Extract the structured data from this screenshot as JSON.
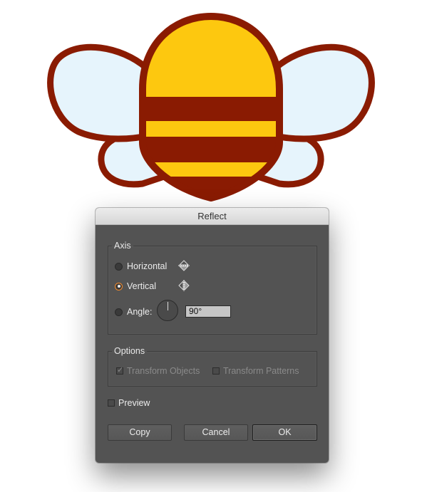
{
  "colors": {
    "outline": "#8a1b02",
    "body_fill": "#fdc80f",
    "wing_fill": "#e6f4fc",
    "dialog_bg": "#535353",
    "radio_accent": "#f28a2e"
  },
  "dialog": {
    "title": "Reflect",
    "axis_group": {
      "legend": "Axis",
      "horizontal_label": "Horizontal",
      "vertical_label": "Vertical",
      "angle_label": "Angle:",
      "angle_value": "90°",
      "selected": "vertical",
      "horizontal_icon": "reflect-horizontal-icon",
      "vertical_icon": "reflect-vertical-icon",
      "angle_dial_icon": "angle-dial-icon"
    },
    "options_group": {
      "legend": "Options",
      "transform_objects_label": "Transform Objects",
      "transform_objects_checked": true,
      "transform_objects_enabled": false,
      "transform_patterns_label": "Transform Patterns",
      "transform_patterns_checked": false,
      "transform_patterns_enabled": false
    },
    "preview_label": "Preview",
    "preview_checked": false,
    "buttons": {
      "copy": "Copy",
      "cancel": "Cancel",
      "ok": "OK"
    }
  }
}
